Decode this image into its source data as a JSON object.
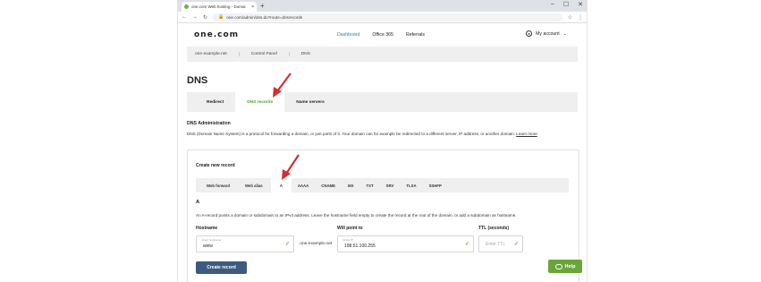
{
  "browser": {
    "tab_title": "one.com Web hosting - Domai",
    "tab_close": "×",
    "new_tab": "+",
    "url": "one.com/admin/dns.do?route=dnsrecords",
    "window_controls": [
      "–",
      "☐",
      "✕"
    ],
    "nav_back": "←",
    "nav_forward": "→",
    "nav_reload": "↻",
    "star": "☆",
    "menu": "⋮",
    "lock": "🔒"
  },
  "site": {
    "logo": "one.com",
    "nav": [
      "Dashboard",
      "Office 365",
      "Referrals"
    ],
    "account": "My account",
    "account_caret": "⌄"
  },
  "breadcrumbs": [
    "one-example.net",
    "Control Panel",
    "DNS"
  ],
  "page": {
    "title": "DNS",
    "tabs": [
      "Redirect",
      "DNS records",
      "Name servers"
    ],
    "section_title": "DNS Administration",
    "description": "DNS (Domain Name System) is a protocol for forwarding a domain, or just parts of it. Your domain can for example be redirected to a different server, IP address, or another domain.",
    "learn_more": "Learn more"
  },
  "create": {
    "title": "Create new record",
    "record_tabs": [
      "Web forward",
      "Web alias",
      "A",
      "AAAA",
      "CNAME",
      "MX",
      "TXT",
      "SRV",
      "TLSA",
      "SSHFP"
    ],
    "selected_type": "A",
    "type_description": "An A-record points a domain or subdomain to an IPv4 address. Leave the hostname field empty to create the record at the root of the domain, or add a subdomain as hostname.",
    "hostname_label": "Hostname",
    "hostname_placeholder": "Enter hostname",
    "hostname_value": "www",
    "domain_suffix": ".one-example.net",
    "pointto_label": "Will point to",
    "pointto_placeholder": "Enter IP",
    "pointto_value": "198.51.100.255",
    "ttl_label": "TTL (seconds)",
    "ttl_placeholder": "Enter TTL",
    "check": "✓",
    "button": "Create record"
  },
  "help": {
    "label": "Help"
  },
  "colors": {
    "accent_blue": "#2f7ac2",
    "accent_green": "#6aa53b",
    "button": "#3d5a80",
    "arrow": "#d32f2f"
  }
}
